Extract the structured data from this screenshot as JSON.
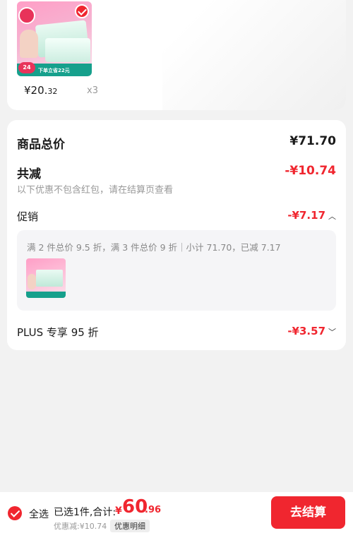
{
  "product": {
    "image_banner": "下单立省22元",
    "image_badge": "24",
    "price_int": "¥20.",
    "price_dec": "32",
    "quantity": "x3"
  },
  "summary": {
    "total_label": "商品总价",
    "total_value": "¥71.70",
    "reduce_label": "共减",
    "reduce_value": "-¥10.74",
    "note": "以下优惠不包含红包，请在结算页查看",
    "promo_label": "促销",
    "promo_value": "-¥7.17",
    "promo_desc": "满 2 件总价 9.5 折，满 3 件总价 9 折｜小计 71.70，已减 7.17",
    "plus_label": "PLUS 专享 95 折",
    "plus_value": "-¥3.57"
  },
  "bottom": {
    "select_all": "全选",
    "selected_text": "已选1件,合计:",
    "total_symbol": "¥",
    "total_int": "60",
    "total_dec": ".96",
    "discount_note": "优惠减:¥10.74",
    "detail_chip": "优惠明细",
    "checkout": "去结算"
  },
  "colors": {
    "accent": "#f0262f",
    "background": "#f2f2f2"
  }
}
